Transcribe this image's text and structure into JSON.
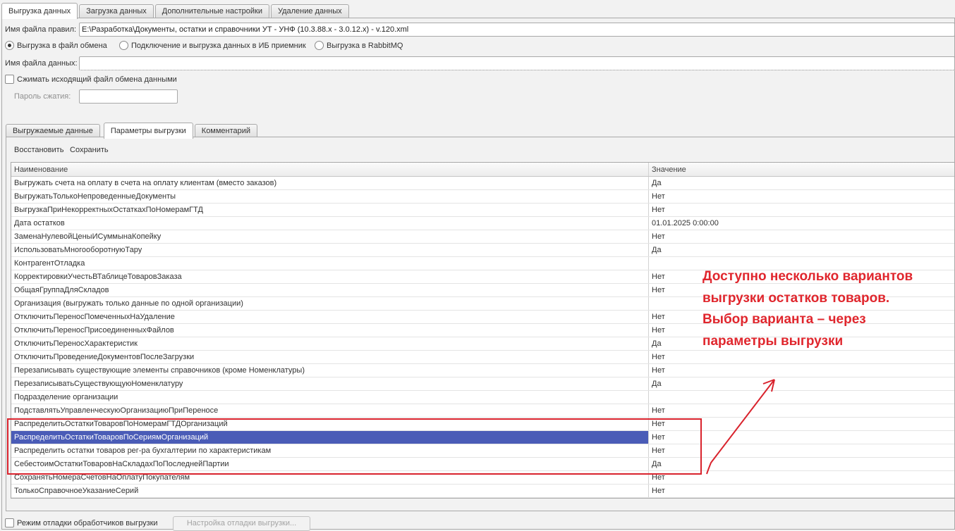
{
  "tabs_top": [
    "Выгрузка данных",
    "Загрузка данных",
    "Дополнительные настройки",
    "Удаление данных"
  ],
  "rules_file": {
    "label": "Имя файла правил:",
    "value": "E:\\Разработка\\Документы, остатки и справочники УТ - УНФ (10.3.88.х - 3.0.12.х) - v.120.xml"
  },
  "export_modes": [
    {
      "label": "Выгрузка в файл обмена",
      "selected": true
    },
    {
      "label": "Подключение и выгрузка данных в ИБ приемник",
      "selected": false
    },
    {
      "label": "Выгрузка в RabbitMQ",
      "selected": false
    }
  ],
  "data_file": {
    "label": "Имя файла данных:",
    "value": ""
  },
  "compress": {
    "label": "Сжимать исходящий файл обмена данными",
    "checked": false
  },
  "password": {
    "label": "Пароль сжатия:",
    "value": ""
  },
  "tabs_inner": [
    "Выгружаемые данные",
    "Параметры выгрузки",
    "Комментарий"
  ],
  "commands": {
    "restore": "Восстановить",
    "save": "Сохранить"
  },
  "table": {
    "columns": [
      "Наименование",
      "Значение"
    ],
    "rows": [
      {
        "name": "Выгружать счета на оплату в счета на оплату клиентам (вместо заказов)",
        "value": "Да"
      },
      {
        "name": "ВыгружатьТолькоНепроведенныеДокументы",
        "value": "Нет"
      },
      {
        "name": "ВыгрузкаПриНекорректныхОстаткахПоНомерамГТД",
        "value": "Нет"
      },
      {
        "name": "Дата остатков",
        "value": "01.01.2025 0:00:00"
      },
      {
        "name": "ЗаменаНулевойЦеныИСуммынаКопейку",
        "value": "Нет"
      },
      {
        "name": "ИспользоватьМногооборотнуюТару",
        "value": "Да"
      },
      {
        "name": "КонтрагентОтладка",
        "value": ""
      },
      {
        "name": "КорректировкиУчестьВТаблицеТоваровЗаказа",
        "value": "Нет"
      },
      {
        "name": "ОбщаяГруппаДляСкладов",
        "value": "Нет"
      },
      {
        "name": "Организация (выгружать только данные по одной организации)",
        "value": ""
      },
      {
        "name": "ОтключитьПереносПомеченныхНаУдаление",
        "value": "Нет"
      },
      {
        "name": "ОтключитьПереносПрисоединенныхФайлов",
        "value": "Нет"
      },
      {
        "name": "ОтключитьПереносХарактеристик",
        "value": "Да"
      },
      {
        "name": "ОтключитьПроведениеДокументовПослеЗагрузки",
        "value": "Нет"
      },
      {
        "name": "Перезаписывать существующие элементы справочников (кроме Номенклатуры)",
        "value": "Нет"
      },
      {
        "name": "ПерезаписыватьСуществующуюНоменклатуру",
        "value": "Да"
      },
      {
        "name": "Подразделение организации",
        "value": ""
      },
      {
        "name": "ПодставлятьУправленческуюОрганизациюПриПереносе",
        "value": "Нет"
      },
      {
        "name": "РаспределитьОстаткиТоваровПоНомерамГТДОрганизаций",
        "value": "Нет"
      },
      {
        "name": "РаспределитьОстаткиТоваровПоСериямОрганизаций",
        "value": "Нет"
      },
      {
        "name": "Распределить остатки товаров рег-ра бухгалтерии по характеристикам",
        "value": "Нет"
      },
      {
        "name": "СебестоимОстаткиТоваровНаСкладахПоПоследнейПартии",
        "value": "Да"
      },
      {
        "name": "СохранятьНомераСчетовНаОплатуПокупателям",
        "value": "Нет"
      },
      {
        "name": "ТолькоСправочноеУказаниеСерий",
        "value": "Нет"
      }
    ],
    "selected_row": 19
  },
  "annotation": "Доступно несколько вариантов выгрузки остатков товаров. Выбор варианта – через параметры выгрузки",
  "debug_mode": {
    "label": "Режим отладки обработчиков выгрузки",
    "checked": false
  },
  "debug_settings_button": "Настройка отладки выгрузки...",
  "colors": {
    "selection": "#4a5cb7",
    "annotation": "#e0262d",
    "highlight_border": "#d9232d"
  }
}
